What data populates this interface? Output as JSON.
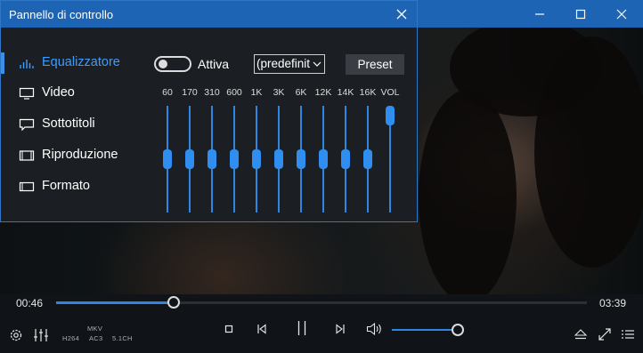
{
  "window": {
    "buttons": [
      {
        "name": "minimize",
        "icon": "minimize-icon"
      },
      {
        "name": "maximize",
        "icon": "maximize-icon"
      },
      {
        "name": "close",
        "icon": "close-icon"
      }
    ]
  },
  "panel": {
    "title": "Pannello di controllo",
    "nav": [
      {
        "label": "Equalizzatore",
        "icon": "equalizer-icon",
        "active": true
      },
      {
        "label": "Video",
        "icon": "monitor-icon",
        "active": false
      },
      {
        "label": "Sottotitoli",
        "icon": "subtitles-icon",
        "active": false
      },
      {
        "label": "Riproduzione",
        "icon": "film-icon",
        "active": false
      },
      {
        "label": "Formato",
        "icon": "aspect-ratio-icon",
        "active": false
      }
    ],
    "equalizer": {
      "enabled_label": "Attiva",
      "enabled": false,
      "preset_value": "(predefinit",
      "preset_button": "Preset",
      "bands": [
        {
          "label": "60",
          "level": 0.5
        },
        {
          "label": "170",
          "level": 0.5
        },
        {
          "label": "310",
          "level": 0.5
        },
        {
          "label": "600",
          "level": 0.5
        },
        {
          "label": "1K",
          "level": 0.5
        },
        {
          "label": "3K",
          "level": 0.5
        },
        {
          "label": "6K",
          "level": 0.5
        },
        {
          "label": "12K",
          "level": 0.5
        },
        {
          "label": "14K",
          "level": 0.5
        },
        {
          "label": "16K",
          "level": 0.5
        },
        {
          "label": "VOL",
          "level": 1.0
        }
      ]
    }
  },
  "player": {
    "elapsed": "00:46",
    "total": "03:39",
    "progress": 0.222,
    "volume": 1.0,
    "media_info": {
      "container": "MKV",
      "video_codec": "H264",
      "audio_codec": "AC3",
      "channels": "5.1CH"
    },
    "controls": {
      "left": [
        "settings-icon",
        "equalizer-sliders-icon"
      ],
      "center": [
        "stop-icon",
        "previous-icon",
        "pause-icon",
        "next-icon",
        "volume-icon"
      ],
      "right": [
        "eject-icon",
        "fullscreen-icon",
        "playlist-icon"
      ]
    }
  },
  "colors": {
    "accent": "#1e64b4",
    "highlight": "#2f8ef0",
    "panel_bg": "#1b1f24",
    "bottom_bar_bg": "#101317"
  }
}
